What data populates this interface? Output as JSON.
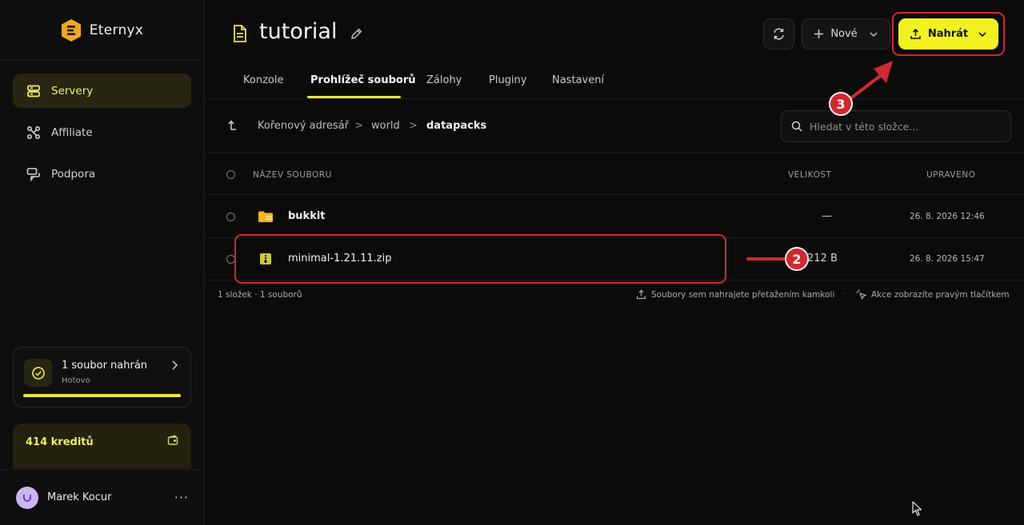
{
  "brand": {
    "name": "Eternyx",
    "logo_icon": "eternyx-logo-icon"
  },
  "sidebar": {
    "items": [
      {
        "label": "Servery",
        "icon": "server-icon",
        "active": true
      },
      {
        "label": "Affiliate",
        "icon": "network-icon",
        "active": false
      },
      {
        "label": "Podpora",
        "icon": "chat-icon",
        "active": false
      }
    ],
    "upload_status": {
      "title": "1 soubor nahrán",
      "subtitle": "Hotovo",
      "progress": 1.0
    },
    "credits": {
      "label": "414 kreditů"
    },
    "user": {
      "name": "Marek Kocur",
      "more": "···"
    }
  },
  "header": {
    "title": "tutorial",
    "new_label": "Nové",
    "upload_label": "Nahrát"
  },
  "tabs": [
    {
      "label": "Konzole",
      "active": false
    },
    {
      "label": "Prohlížeč souborů",
      "active": true
    },
    {
      "label": "Zálohy",
      "active": false
    },
    {
      "label": "Pluginy",
      "active": false
    },
    {
      "label": "Nastavení",
      "active": false
    }
  ],
  "breadcrumb": {
    "items": [
      "Kořenový adresář",
      "world",
      "datapacks"
    ],
    "separator": ">"
  },
  "search": {
    "placeholder": "Hledat v této složce..."
  },
  "table": {
    "columns": {
      "name": "NÁZEV SOUBORU",
      "size": "VELIKOST",
      "modified": "UPRAVENO"
    },
    "rows": [
      {
        "name": "bukkit",
        "type": "folder",
        "size": "—",
        "modified": "26. 8. 2026 12:46"
      },
      {
        "name": "minimal-1.21.11.zip",
        "type": "zip",
        "size": "212 B",
        "modified": "26. 8. 2026 15:47"
      }
    ]
  },
  "footer": {
    "summary": "1 složek · 1 souborů",
    "hint_drag": "Soubory sem nahrajete přetažením kamkoli",
    "dot": "·",
    "hint_right_click": "Akce zobrazíte pravým tlačítkem"
  },
  "annotations": {
    "badge_2": "2",
    "badge_3": "3"
  },
  "colors": {
    "accent": "#f2f21f",
    "annotation": "#d2282e",
    "background": "#0b0b0b"
  }
}
